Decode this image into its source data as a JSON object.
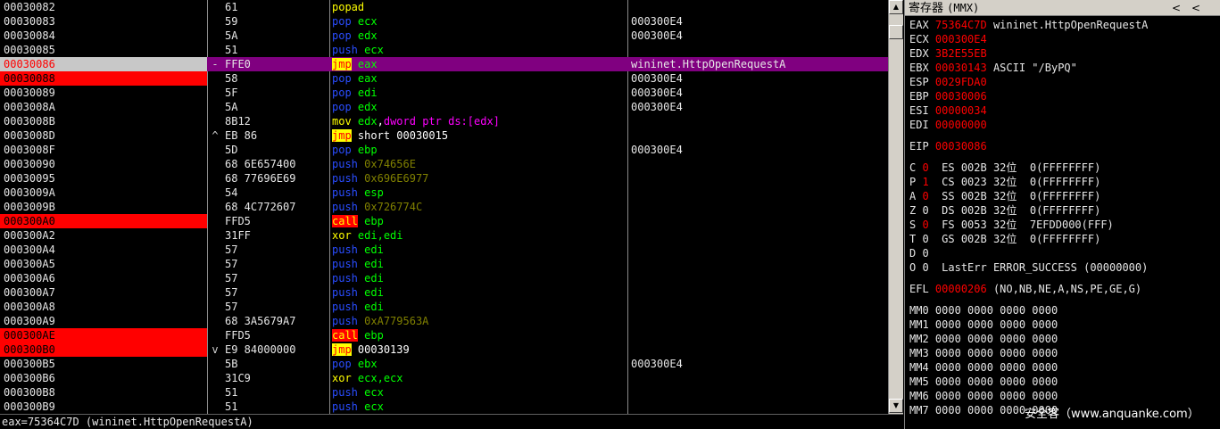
{
  "disasm": {
    "rows": [
      {
        "addr": "00030082",
        "hex": "61",
        "mnem": "popad",
        "mclass": "popad",
        "ops": [],
        "comment": ""
      },
      {
        "addr": "00030083",
        "hex": "59",
        "mnem": "pop",
        "mclass": "pop",
        "ops": [
          {
            "t": "ecx",
            "c": "reg"
          }
        ],
        "comment": "000300E4"
      },
      {
        "addr": "00030084",
        "hex": "5A",
        "mnem": "pop",
        "mclass": "pop",
        "ops": [
          {
            "t": "edx",
            "c": "reg"
          }
        ],
        "comment": "000300E4"
      },
      {
        "addr": "00030085",
        "hex": "51",
        "mnem": "push",
        "mclass": "push",
        "ops": [
          {
            "t": "ecx",
            "c": "reg"
          }
        ],
        "comment": ""
      },
      {
        "addr": "00030086",
        "hex": "FFE0",
        "mnem": "jmp",
        "mclass": "jmp",
        "ops": [
          {
            "t": "eax",
            "c": "reg"
          }
        ],
        "comment": "wininet.HttpOpenRequestA",
        "mark": "-",
        "state": "current"
      },
      {
        "addr": "00030088",
        "hex": "58",
        "mnem": "pop",
        "mclass": "pop",
        "ops": [
          {
            "t": "eax",
            "c": "reg"
          }
        ],
        "comment": "000300E4",
        "state": "bp"
      },
      {
        "addr": "00030089",
        "hex": "5F",
        "mnem": "pop",
        "mclass": "pop",
        "ops": [
          {
            "t": "edi",
            "c": "reg"
          }
        ],
        "comment": "000300E4"
      },
      {
        "addr": "0003008A",
        "hex": "5A",
        "mnem": "pop",
        "mclass": "pop",
        "ops": [
          {
            "t": "edx",
            "c": "reg"
          }
        ],
        "comment": "000300E4"
      },
      {
        "addr": "0003008B",
        "hex": "8B12",
        "mnem": "mov",
        "mclass": "mov",
        "ops": [
          {
            "t": "edx",
            "c": "reg"
          },
          {
            "t": ",",
            "c": "addr"
          },
          {
            "t": "dword ptr ds:[edx]",
            "c": "mem"
          }
        ],
        "comment": ""
      },
      {
        "addr": "0003008D",
        "hex": "EB 86",
        "mnem": "jmp",
        "mclass": "jmp",
        "ops": [
          {
            "t": "short 00030015",
            "c": "short"
          }
        ],
        "comment": "",
        "mark": "^"
      },
      {
        "addr": "0003008F",
        "hex": "5D",
        "mnem": "pop",
        "mclass": "pop",
        "ops": [
          {
            "t": "ebp",
            "c": "reg"
          }
        ],
        "comment": "000300E4"
      },
      {
        "addr": "00030090",
        "hex": "68 6E657400",
        "mnem": "push",
        "mclass": "push",
        "ops": [
          {
            "t": "0x74656E",
            "c": "imm"
          }
        ],
        "comment": ""
      },
      {
        "addr": "00030095",
        "hex": "68 77696E69",
        "mnem": "push",
        "mclass": "push",
        "ops": [
          {
            "t": "0x696E6977",
            "c": "imm"
          }
        ],
        "comment": ""
      },
      {
        "addr": "0003009A",
        "hex": "54",
        "mnem": "push",
        "mclass": "push",
        "ops": [
          {
            "t": "esp",
            "c": "reg"
          }
        ],
        "comment": ""
      },
      {
        "addr": "0003009B",
        "hex": "68 4C772607",
        "mnem": "push",
        "mclass": "push",
        "ops": [
          {
            "t": "0x726774C",
            "c": "imm"
          }
        ],
        "comment": ""
      },
      {
        "addr": "000300A0",
        "hex": "FFD5",
        "mnem": "call",
        "mclass": "call",
        "ops": [
          {
            "t": "ebp",
            "c": "reg"
          }
        ],
        "comment": "",
        "state": "bp"
      },
      {
        "addr": "000300A2",
        "hex": "31FF",
        "mnem": "xor",
        "mclass": "xor",
        "ops": [
          {
            "t": "edi,edi",
            "c": "reg"
          }
        ],
        "comment": ""
      },
      {
        "addr": "000300A4",
        "hex": "57",
        "mnem": "push",
        "mclass": "push",
        "ops": [
          {
            "t": "edi",
            "c": "reg"
          }
        ],
        "comment": ""
      },
      {
        "addr": "000300A5",
        "hex": "57",
        "mnem": "push",
        "mclass": "push",
        "ops": [
          {
            "t": "edi",
            "c": "reg"
          }
        ],
        "comment": ""
      },
      {
        "addr": "000300A6",
        "hex": "57",
        "mnem": "push",
        "mclass": "push",
        "ops": [
          {
            "t": "edi",
            "c": "reg"
          }
        ],
        "comment": ""
      },
      {
        "addr": "000300A7",
        "hex": "57",
        "mnem": "push",
        "mclass": "push",
        "ops": [
          {
            "t": "edi",
            "c": "reg"
          }
        ],
        "comment": ""
      },
      {
        "addr": "000300A8",
        "hex": "57",
        "mnem": "push",
        "mclass": "push",
        "ops": [
          {
            "t": "edi",
            "c": "reg"
          }
        ],
        "comment": ""
      },
      {
        "addr": "000300A9",
        "hex": "68 3A5679A7",
        "mnem": "push",
        "mclass": "push",
        "ops": [
          {
            "t": "0xA779563A",
            "c": "imm"
          }
        ],
        "comment": ""
      },
      {
        "addr": "000300AE",
        "hex": "FFD5",
        "mnem": "call",
        "mclass": "call",
        "ops": [
          {
            "t": "ebp",
            "c": "reg"
          }
        ],
        "comment": "",
        "state": "bp"
      },
      {
        "addr": "000300B0",
        "hex": "E9 84000000",
        "mnem": "jmp",
        "mclass": "jmp",
        "ops": [
          {
            "t": "00030139",
            "c": "addr"
          }
        ],
        "comment": "",
        "mark": "v",
        "state": "bp"
      },
      {
        "addr": "000300B5",
        "hex": "5B",
        "mnem": "pop",
        "mclass": "pop",
        "ops": [
          {
            "t": "ebx",
            "c": "reg"
          }
        ],
        "comment": "000300E4"
      },
      {
        "addr": "000300B6",
        "hex": "31C9",
        "mnem": "xor",
        "mclass": "xor",
        "ops": [
          {
            "t": "ecx,ecx",
            "c": "reg"
          }
        ],
        "comment": ""
      },
      {
        "addr": "000300B8",
        "hex": "51",
        "mnem": "push",
        "mclass": "push",
        "ops": [
          {
            "t": "ecx",
            "c": "reg"
          }
        ],
        "comment": ""
      },
      {
        "addr": "000300B9",
        "hex": "51",
        "mnem": "push",
        "mclass": "push",
        "ops": [
          {
            "t": "ecx",
            "c": "reg"
          }
        ],
        "comment": ""
      }
    ],
    "selected_addr": "00030086"
  },
  "statusbar": {
    "text": "eax=75364C7D (wininet.HttpOpenRequestA)"
  },
  "scrollbar": {
    "up_glyph": "▲",
    "down_glyph": "▼"
  },
  "registers": {
    "title": "寄存器",
    "mode": "(MMX)",
    "nav_prev": "<",
    "nav_next": "<",
    "gp": [
      {
        "name": "EAX",
        "value": "75364C7D",
        "note": "wininet.HttpOpenRequestA"
      },
      {
        "name": "ECX",
        "value": "000300E4",
        "note": ""
      },
      {
        "name": "EDX",
        "value": "3B2E55EB",
        "note": ""
      },
      {
        "name": "EBX",
        "value": "00030143",
        "note": "ASCII \"/ByPQ\""
      },
      {
        "name": "ESP",
        "value": "0029FDA0",
        "note": ""
      },
      {
        "name": "EBP",
        "value": "00030006",
        "note": ""
      },
      {
        "name": "ESI",
        "value": "00000034",
        "note": ""
      },
      {
        "name": "EDI",
        "value": "00000000",
        "note": ""
      }
    ],
    "eip": {
      "name": "EIP",
      "value": "00030086"
    },
    "flags": [
      {
        "flag": "C",
        "val": "0",
        "changed": true,
        "seg": "ES 002B 32位  0(FFFFFFFF)"
      },
      {
        "flag": "P",
        "val": "1",
        "changed": true,
        "seg": "CS 0023 32位  0(FFFFFFFF)"
      },
      {
        "flag": "A",
        "val": "0",
        "changed": true,
        "seg": "SS 002B 32位  0(FFFFFFFF)"
      },
      {
        "flag": "Z",
        "val": "0",
        "changed": false,
        "seg": "DS 002B 32位  0(FFFFFFFF)"
      },
      {
        "flag": "S",
        "val": "0",
        "changed": true,
        "seg": "FS 0053 32位  7EFDD000(FFF)"
      },
      {
        "flag": "T",
        "val": "0",
        "changed": false,
        "seg": "GS 002B 32位  0(FFFFFFFF)"
      },
      {
        "flag": "D",
        "val": "0",
        "changed": false,
        "seg": ""
      },
      {
        "flag": "O",
        "val": "0",
        "changed": false,
        "seg": "LastErr ERROR_SUCCESS (00000000)"
      }
    ],
    "efl": {
      "name": "EFL",
      "value": "00000206",
      "note": "(NO,NB,NE,A,NS,PE,GE,G)"
    },
    "mmx": [
      {
        "name": "MM0",
        "value": "0000 0000 0000 0000"
      },
      {
        "name": "MM1",
        "value": "0000 0000 0000 0000"
      },
      {
        "name": "MM2",
        "value": "0000 0000 0000 0000"
      },
      {
        "name": "MM3",
        "value": "0000 0000 0000 0000"
      },
      {
        "name": "MM4",
        "value": "0000 0000 0000 0000"
      },
      {
        "name": "MM5",
        "value": "0000 0000 0000 0000"
      },
      {
        "name": "MM6",
        "value": "0000 0000 0000 0000"
      },
      {
        "name": "MM7",
        "value": "0000 0000 0000 0000"
      }
    ]
  },
  "watermark": "安全客（www.anquanke.com）",
  "colors": {
    "current_row_bg": "#800080",
    "breakpoint_bg": "#ff0000",
    "selected_addr_bg": "#c8c8c8",
    "register_changed": "#ff0000"
  }
}
